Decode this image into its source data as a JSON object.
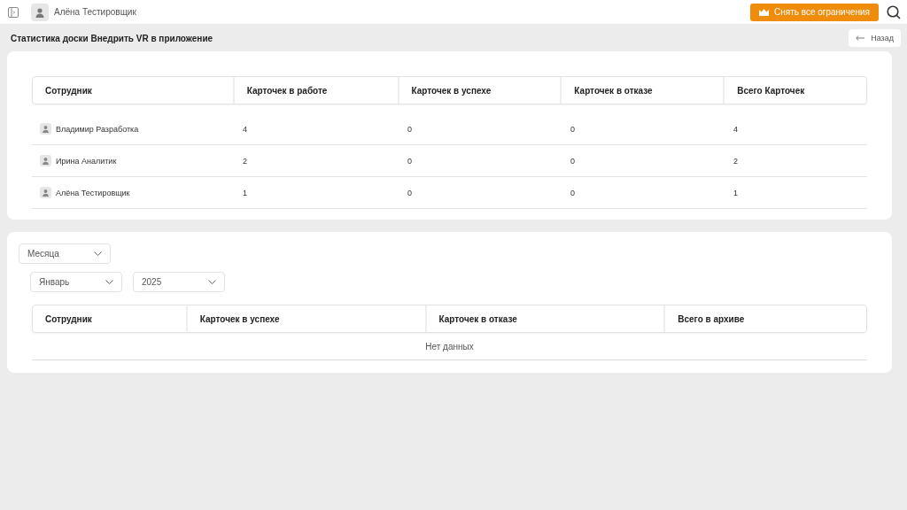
{
  "topbar": {
    "user": "Алёна Тестировщик",
    "unlock_button": "Снять все ограничения"
  },
  "page": {
    "title": "Статистика доски Внедрить VR в приложение",
    "back_button": "Назад"
  },
  "stats_table": {
    "columns": [
      "Сотрудник",
      "Карточек в работе",
      "Карточек в успехе",
      "Карточек в отказе",
      "Всего Карточек"
    ],
    "rows": [
      [
        "Владимир Разработка",
        "4",
        "0",
        "0",
        "4"
      ],
      [
        "Ирина Аналитик",
        "2",
        "0",
        "0",
        "2"
      ],
      [
        "Алёна Тестировщик",
        "1",
        "0",
        "0",
        "1"
      ]
    ]
  },
  "archive": {
    "period_select": "Месяца",
    "month_select": "Январь",
    "year_select": "2025",
    "columns": [
      "Сотрудник",
      "Карточек в успехе",
      "Карточек в отказе",
      "Всего в архиве"
    ],
    "empty_text": "Нет данных"
  }
}
